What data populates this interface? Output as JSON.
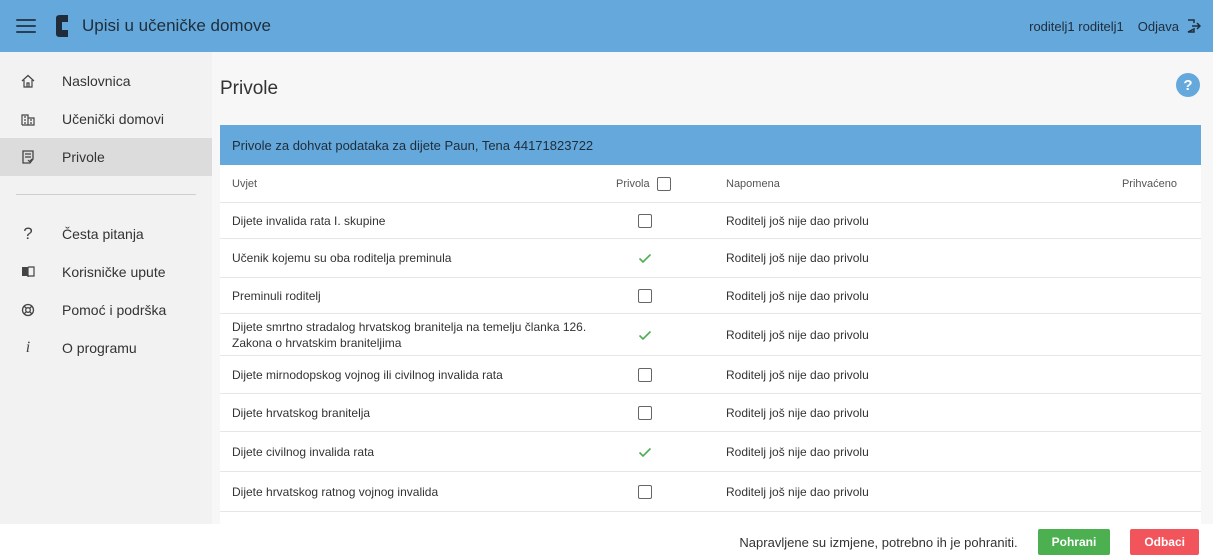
{
  "header": {
    "app_title": "Upisi u učeničke domove",
    "user": "roditelj1 roditelj1",
    "logout": "Odjava"
  },
  "sidebar": {
    "items": [
      {
        "label": "Naslovnica",
        "icon": "home-icon"
      },
      {
        "label": "Učenički domovi",
        "icon": "building-icon"
      },
      {
        "label": "Privole",
        "icon": "document-check-icon"
      },
      {
        "label": "Česta pitanja",
        "icon": "question-icon"
      },
      {
        "label": "Korisničke upute",
        "icon": "book-icon"
      },
      {
        "label": "Pomoć i podrška",
        "icon": "support-icon"
      },
      {
        "label": "O programu",
        "icon": "info-icon"
      }
    ]
  },
  "main": {
    "title": "Privole",
    "help": "?",
    "card_title": "Privole za dohvat podataka za dijete Paun, Tena 44171823722",
    "columns": {
      "condition": "Uvjet",
      "consent": "Privola",
      "note": "Napomena",
      "accepted": "Prihvaćeno"
    },
    "rows": [
      {
        "condition": "Dijete invalida rata I. skupine",
        "checked": false,
        "note": "Roditelj još nije dao privolu"
      },
      {
        "condition": "Učenik kojemu su oba roditelja preminula",
        "checked": true,
        "note": "Roditelj još nije dao privolu"
      },
      {
        "condition": "Preminuli roditelj",
        "checked": false,
        "note": "Roditelj još nije dao privolu"
      },
      {
        "condition": "Dijete smrtno stradalog hrvatskog branitelja na temelju članka 126. Zakona o hrvatskim braniteljima",
        "checked": true,
        "note": "Roditelj još nije dao privolu"
      },
      {
        "condition": "Dijete mirnodopskog vojnog ili civilnog invalida rata",
        "checked": false,
        "note": "Roditelj još nije dao privolu"
      },
      {
        "condition": "Dijete hrvatskog branitelja",
        "checked": false,
        "note": "Roditelj još nije dao privolu"
      },
      {
        "condition": "Dijete civilnog invalida rata",
        "checked": true,
        "note": "Roditelj još nije dao privolu"
      },
      {
        "condition": "Dijete hrvatskog ratnog vojnog invalida",
        "checked": false,
        "note": "Roditelj još nije dao privolu"
      }
    ]
  },
  "footer": {
    "message": "Napravljene su izmjene, potrebno ih je pohraniti.",
    "save": "Pohrani",
    "cancel": "Odbaci"
  },
  "colors": {
    "accent": "#64a8dc",
    "save": "#4caf50",
    "cancel": "#f2545b",
    "check": "#4caf50"
  }
}
